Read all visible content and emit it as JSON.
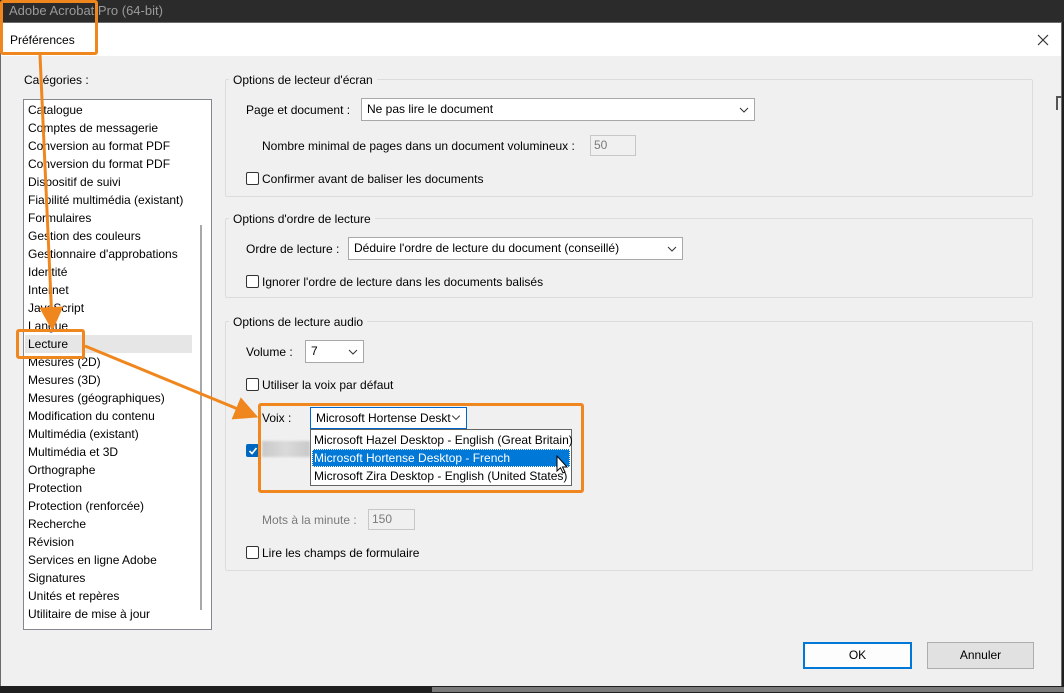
{
  "app": {
    "title": "Adobe Acrobat Pro (64-bit)"
  },
  "dialog": {
    "title": "Préférences",
    "close_icon": "close-icon"
  },
  "categories": {
    "label": "Catégories :",
    "items": [
      "Catalogue",
      "Comptes de messagerie",
      "Conversion au format PDF",
      "Conversion du format PDF",
      "Dispositif de suivi",
      "Fiabilité multimédia (existant)",
      "Formulaires",
      "Gestion des couleurs",
      "Gestionnaire d'approbations",
      "Identité",
      "Internet",
      "JavaScript",
      "Langue",
      "Lecture",
      "Mesures (2D)",
      "Mesures (3D)",
      "Mesures (géographiques)",
      "Modification du contenu",
      "Multimédia (existant)",
      "Multimédia et 3D",
      "Orthographe",
      "Protection",
      "Protection (renforcée)",
      "Recherche",
      "Révision",
      "Services en ligne Adobe",
      "Signatures",
      "Unités et repères",
      "Utilitaire de mise à jour"
    ],
    "selected": "Lecture"
  },
  "screen_reader": {
    "group_title": "Options de lecteur d'écran",
    "page_doc_label": "Page et document :",
    "page_doc_value": "Ne pas lire le document",
    "min_pages_label": "Nombre minimal de pages dans un document volumineux :",
    "min_pages_value": "50",
    "confirm_tag_label": "Confirmer avant de baliser les documents"
  },
  "reading_order": {
    "group_title": "Options d'ordre de lecture",
    "order_label": "Ordre de lecture :",
    "order_value": "Déduire l'ordre de lecture du document (conseillé)",
    "ignore_label": "Ignorer l'ordre de lecture dans les documents balisés"
  },
  "audio": {
    "group_title": "Options de lecture audio",
    "volume_label": "Volume :",
    "volume_value": "7",
    "default_voice_label": "Utiliser la voix par défaut",
    "voice_label": "Voix :",
    "voice_value": "Microsoft Hortense Deskt",
    "voice_options": [
      "Microsoft Hazel Desktop - English (Great Britain)",
      "Microsoft Hortense Desktop - French",
      "Microsoft Zira Desktop - English (United States)"
    ],
    "voice_highlighted": "Microsoft Hortense Desktop - French",
    "wpm_label": "Mots à la minute :",
    "wpm_value": "150",
    "form_fields_label": "Lire les champs de formulaire"
  },
  "buttons": {
    "ok": "OK",
    "cancel": "Annuler"
  },
  "colors": {
    "annotation": "#f0871e",
    "accent": "#0078d7",
    "highlight": "#0078d7"
  }
}
